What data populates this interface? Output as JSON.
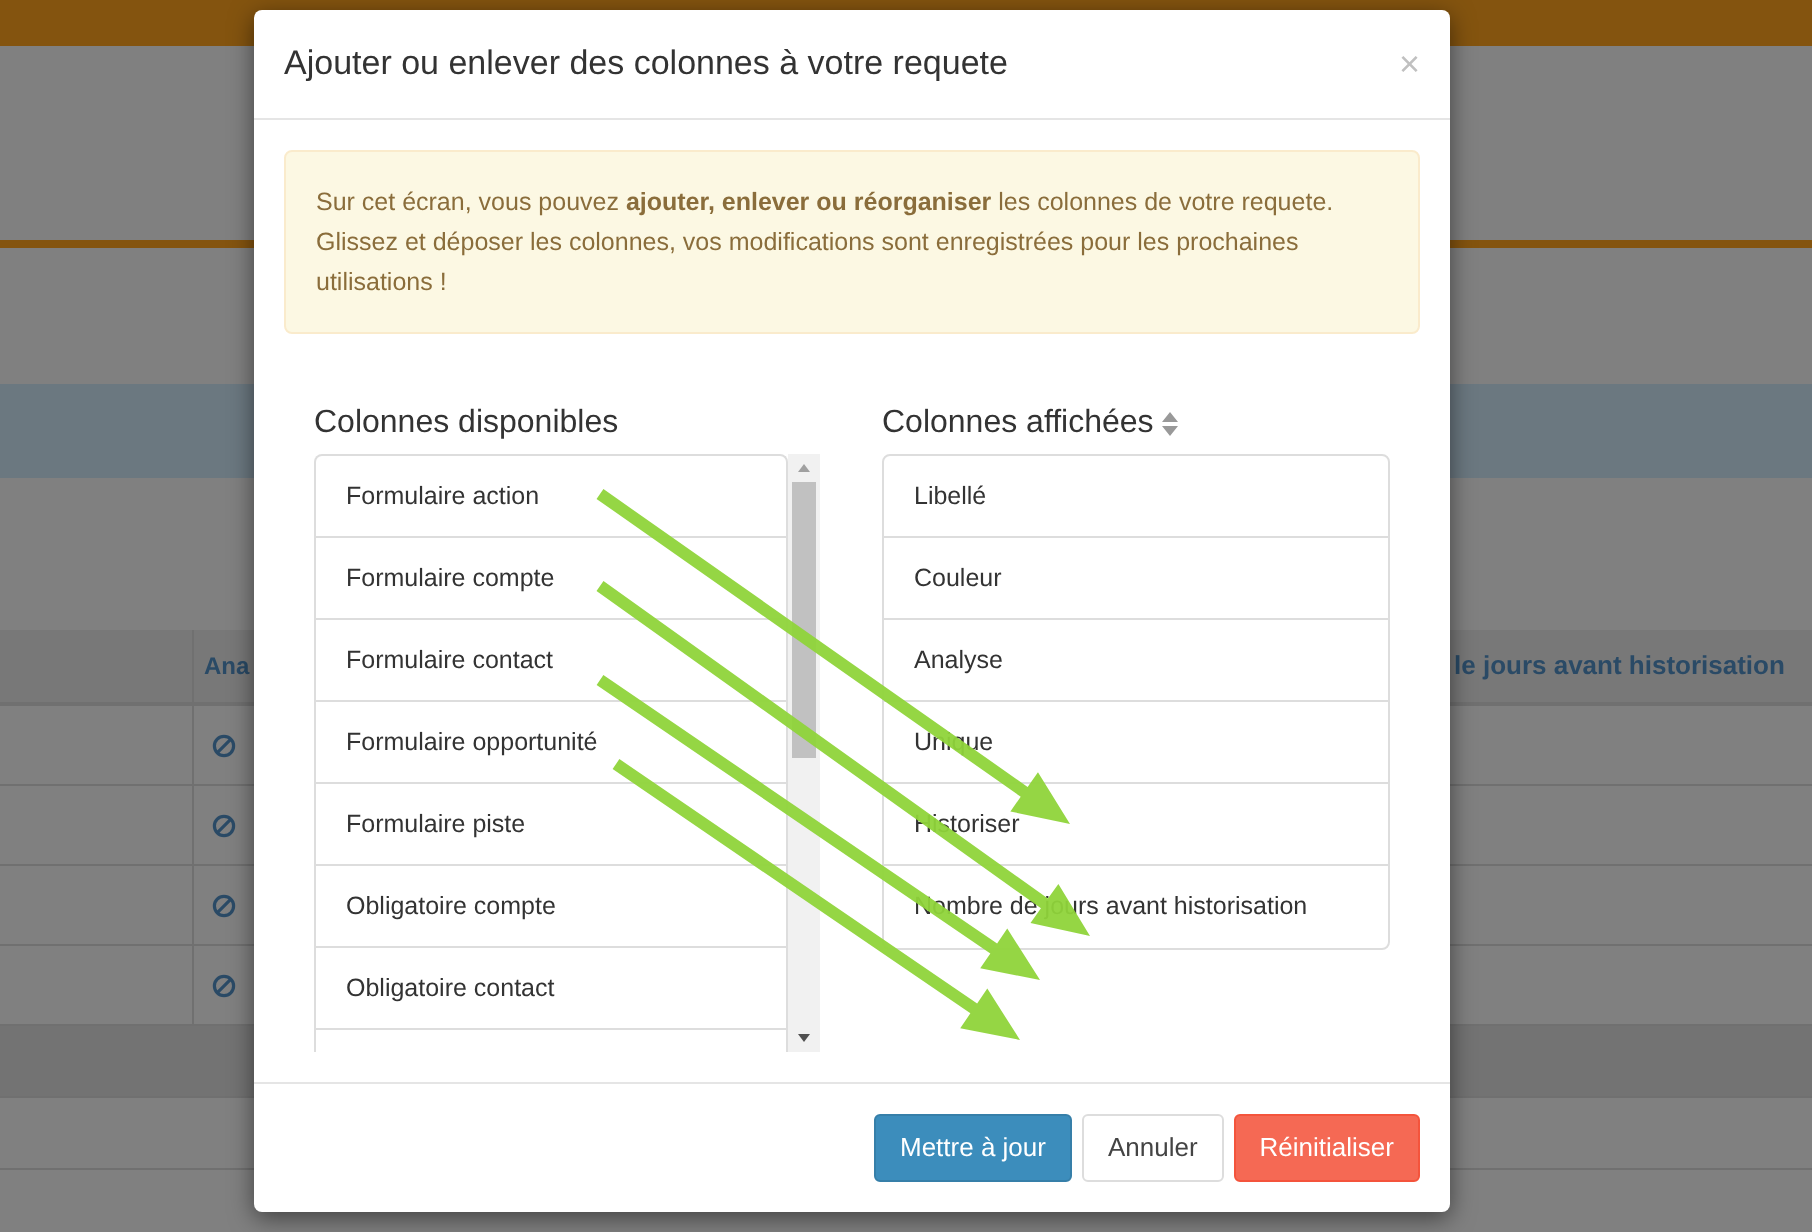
{
  "background": {
    "table": {
      "column_1": "Ana",
      "column_2": "le jours avant historisation"
    }
  },
  "dialog": {
    "title": "Ajouter ou enlever des colonnes à votre requete",
    "close": "×",
    "alert": "Sur cet écran, vous pouvez **ajouter, enlever ou réorganiser** les colonnes de votre requete. Glissez et déposer les colonnes, vos modifications sont enregistrées pour les prochaines utilisations !",
    "available": {
      "heading": "Colonnes disponibles",
      "items": [
        "Formulaire action",
        "Formulaire compte",
        "Formulaire contact",
        "Formulaire opportunité",
        "Formulaire piste",
        "Obligatoire compte",
        "Obligatoire contact"
      ]
    },
    "displayed": {
      "heading": "Colonnes affichées",
      "items": [
        "Libellé",
        "Couleur",
        "Analyse",
        "Unique",
        "Historiser",
        "Nombre de jours avant historisation"
      ]
    },
    "buttons": [
      {
        "label": "Mettre à jour",
        "kind": "primary"
      },
      {
        "label": "Annuler",
        "kind": "default"
      },
      {
        "label": "Réinitialiser",
        "kind": "danger"
      }
    ]
  }
}
